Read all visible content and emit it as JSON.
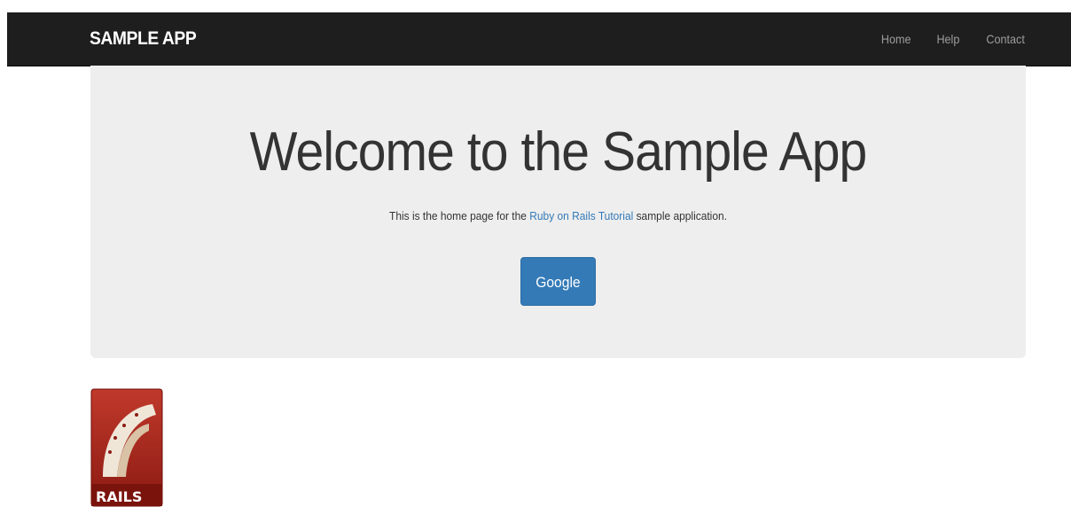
{
  "navbar": {
    "brand": "SAMPLE APP",
    "links": [
      {
        "label": "Home"
      },
      {
        "label": "Help"
      },
      {
        "label": "Contact"
      }
    ],
    "background": "#1e1e1e"
  },
  "jumbotron": {
    "title": "Welcome to the Sample App",
    "text_before": "This is the home page for the ",
    "link_text": "Ruby on Rails Tutorial",
    "text_after": " sample application.",
    "button_label": "Google",
    "background": "#eeeeee",
    "accent": "#337ab7"
  },
  "logo": {
    "name": "rails-logo",
    "text": "RAILS"
  }
}
